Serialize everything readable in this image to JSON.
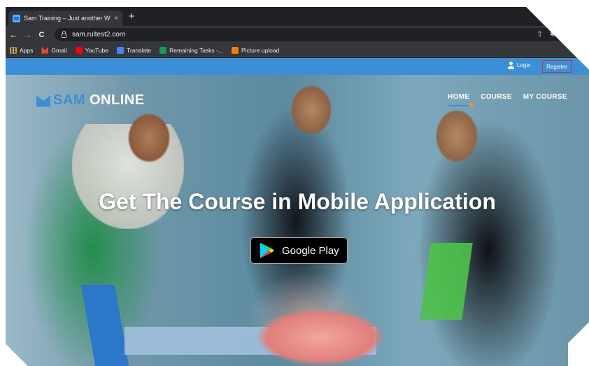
{
  "browser": {
    "tab_title": "Sam Training – Just another W",
    "tab_close": "×",
    "new_tab": "+",
    "url": "sam.rultest2.com",
    "back": "←",
    "forward": "→",
    "reload": "C",
    "omnibox_icons": [
      "⇪",
      "☆"
    ],
    "extension_icons": [
      "✱",
      "▯"
    ]
  },
  "bookmarks": [
    {
      "label": "Apps",
      "icon": "apps-icon"
    },
    {
      "label": "Gmail",
      "icon": "gmail-icon"
    },
    {
      "label": "YouTube",
      "icon": "youtube-icon"
    },
    {
      "label": "Translate",
      "icon": "translate-icon"
    },
    {
      "label": "Remaining Tasks -...",
      "icon": "tasks-icon"
    },
    {
      "label": "Picture upload",
      "icon": "picture-icon"
    }
  ],
  "topbar": {
    "login": "Login",
    "register": "Register"
  },
  "site": {
    "logo_part1": "SAM ",
    "logo_part2": "ONLINE",
    "nav": [
      "HOME",
      "COURSE",
      "MY COURSE"
    ]
  },
  "hero": {
    "headline": "Get The Course in Mobile Application",
    "store_button": "Google Play"
  },
  "colors": {
    "accent": "#3a8fd6",
    "register_border": "#d9302c",
    "nav_dot": "#f29229"
  }
}
